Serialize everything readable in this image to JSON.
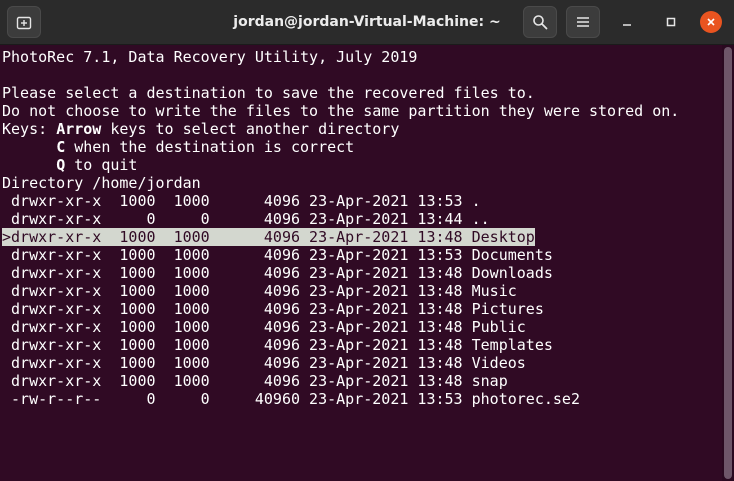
{
  "window": {
    "title": "jordan@jordan-Virtual-Machine: ~"
  },
  "icons": {
    "new_tab": "new-tab-icon",
    "search": "search-icon",
    "menu": "hamburger-menu-icon",
    "minimize": "minimize-icon",
    "maximize": "maximize-icon",
    "close": "close-icon"
  },
  "colors": {
    "terminal_bg": "#300a24",
    "close_button": "#e95420",
    "selection_bg": "#d3d7cf"
  },
  "terminal": {
    "header": "PhotoRec 7.1, Data Recovery Utility, July 2019",
    "instruction1": "Please select a destination to save the recovered files to.",
    "instruction2": "Do not choose to write the files to the same partition they were stored on.",
    "keys_prefix": "Keys: ",
    "keys_arrow": "Arrow",
    "keys_arrow_desc": " keys to select another directory",
    "keys_indent": "      ",
    "key_c": "C",
    "key_c_desc": " when the destination is correct",
    "key_q": "Q",
    "key_q_desc": " to quit",
    "directory_line": "Directory /home/jordan",
    "selected_index": 2,
    "entries": [
      {
        "line": " drwxr-xr-x  1000  1000      4096 23-Apr-2021 13:53 ."
      },
      {
        "line": " drwxr-xr-x     0     0      4096 23-Apr-2021 13:44 .."
      },
      {
        "line": ">drwxr-xr-x  1000  1000      4096 23-Apr-2021 13:48 Desktop"
      },
      {
        "line": " drwxr-xr-x  1000  1000      4096 23-Apr-2021 13:53 Documents"
      },
      {
        "line": " drwxr-xr-x  1000  1000      4096 23-Apr-2021 13:48 Downloads"
      },
      {
        "line": " drwxr-xr-x  1000  1000      4096 23-Apr-2021 13:48 Music"
      },
      {
        "line": " drwxr-xr-x  1000  1000      4096 23-Apr-2021 13:48 Pictures"
      },
      {
        "line": " drwxr-xr-x  1000  1000      4096 23-Apr-2021 13:48 Public"
      },
      {
        "line": " drwxr-xr-x  1000  1000      4096 23-Apr-2021 13:48 Templates"
      },
      {
        "line": " drwxr-xr-x  1000  1000      4096 23-Apr-2021 13:48 Videos"
      },
      {
        "line": " drwxr-xr-x  1000  1000      4096 23-Apr-2021 13:48 snap"
      },
      {
        "line": " -rw-r--r--     0     0     40960 23-Apr-2021 13:53 photorec.se2"
      }
    ]
  }
}
